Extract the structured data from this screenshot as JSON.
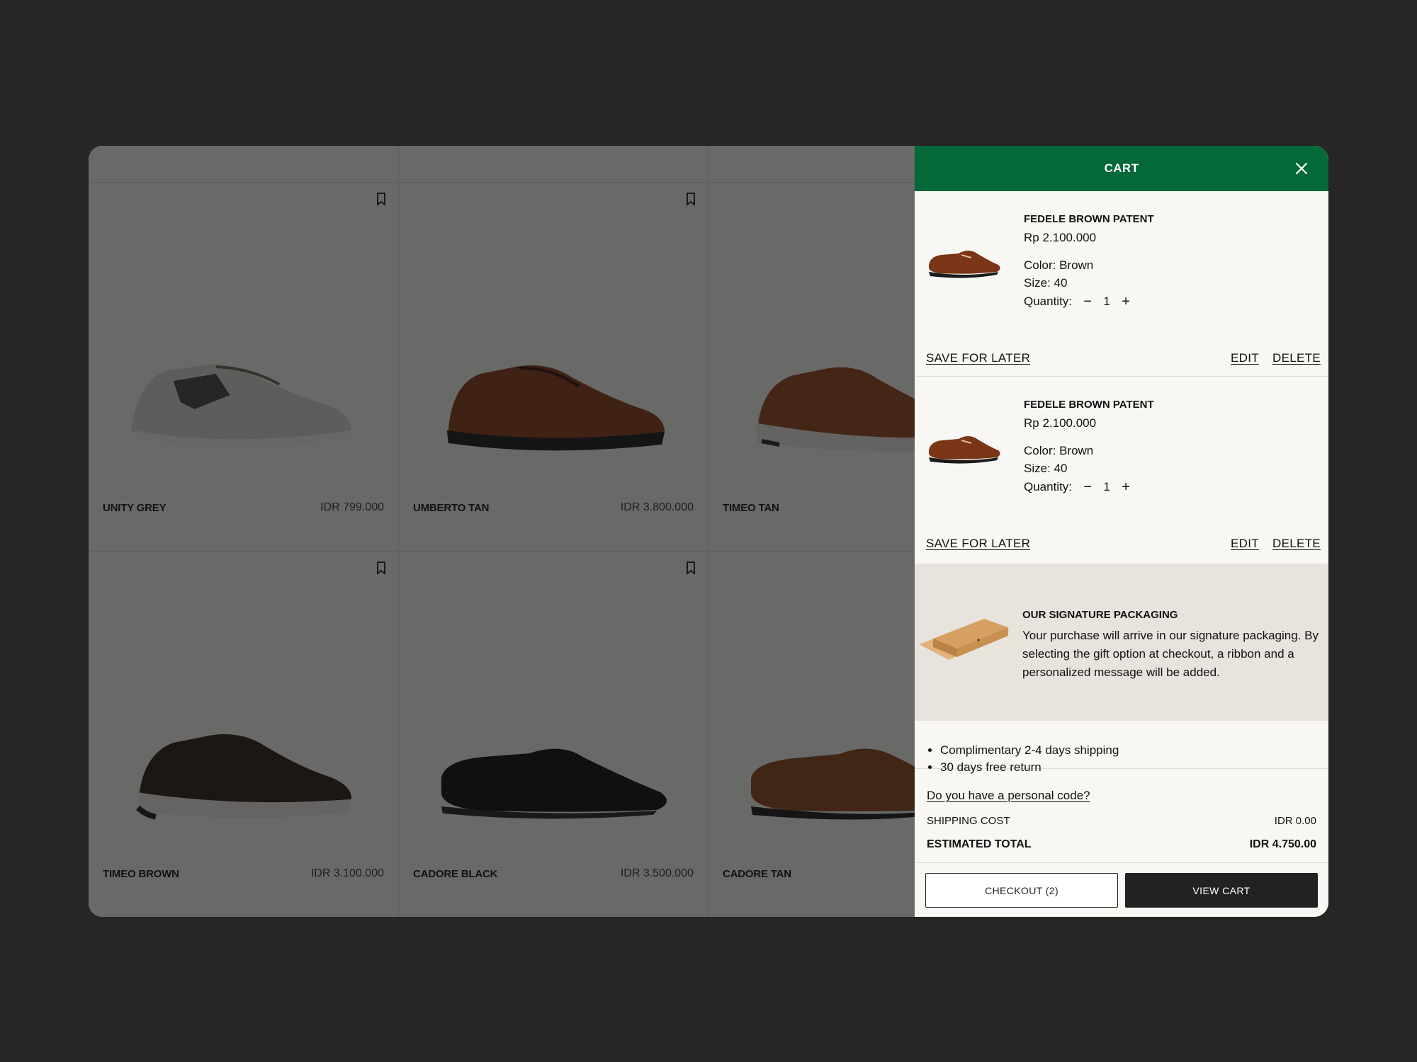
{
  "products": [
    {
      "name": "UNITY GREY",
      "price": "IDR 799.000",
      "shoe": "sneaker-grey"
    },
    {
      "name": "UMBERTO TAN",
      "price": "IDR 3.800.000",
      "shoe": "sneaker-tan"
    },
    {
      "name": "TIMEO TAN",
      "price": "",
      "shoe": "sneaker-tan-white"
    },
    {
      "name": "TIMEO BROWN",
      "price": "IDR 3.100.000",
      "shoe": "sneaker-brown"
    },
    {
      "name": "CADORE BLACK",
      "price": "IDR 3.500.000",
      "shoe": "loafer-black"
    },
    {
      "name": "CADORE TAN",
      "price": "",
      "shoe": "loafer-tan"
    }
  ],
  "cart": {
    "title": "CART",
    "items": [
      {
        "name": "FEDELE BROWN PATENT",
        "price": "Rp 2.100.000",
        "color": "Color: Brown",
        "size": "Size: 40",
        "qty_label": "Quantity:",
        "qty": "1",
        "save_label": "SAVE FOR LATER",
        "edit_label": "EDIT",
        "delete_label": "DELETE"
      },
      {
        "name": "FEDELE BROWN PATENT",
        "price": "Rp 2.100.000",
        "color": "Color: Brown",
        "size": "Size: 40",
        "qty_label": "Quantity:",
        "qty": "1",
        "save_label": "SAVE FOR LATER",
        "edit_label": "EDIT",
        "delete_label": "DELETE"
      }
    ],
    "packaging": {
      "title": "OUR SIGNATURE PACKAGING",
      "text": "Your purchase will arrive in our signature packaging. By selecting the gift option at checkout, a ribbon and a personalized message will be added."
    },
    "perks": [
      "Complimentary 2-4 days shipping",
      "30 days free return"
    ],
    "code_link": "Do you have a personal code?",
    "shipping_label": "SHIPPING COST",
    "shipping_value": "IDR 0.00",
    "total_label": "ESTIMATED TOTAL",
    "total_value": "IDR 4.750.00",
    "checkout_label": "CHECKOUT (2)",
    "view_label": "VIEW CART"
  },
  "colors": {
    "brand_green": "#046938",
    "dark": "#222222"
  }
}
